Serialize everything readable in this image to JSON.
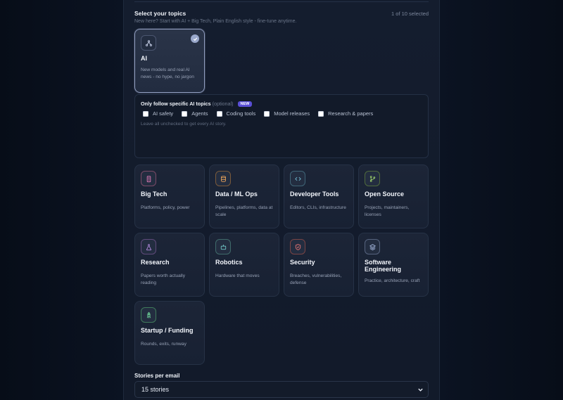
{
  "topics": {
    "title": "Select your topics",
    "count": "1 of 10 selected",
    "subtitle": "New here? Start with AI + Big Tech, Plain English style - fine-tune anytime."
  },
  "cards": [
    {
      "title": "AI",
      "desc": "New models and real AI news - no hype, no jargon",
      "icon": "network-icon",
      "color": "#aab4d4",
      "selected": true
    },
    {
      "title": "Big Tech",
      "desc": "Platforms, policy, power",
      "icon": "building-icon",
      "color": "#e07ab6"
    },
    {
      "title": "Data / ML Ops",
      "desc": "Pipelines, platforms, data at scale",
      "icon": "database-icon",
      "color": "#e8a25a"
    },
    {
      "title": "Developer Tools",
      "desc": "Editors, CLIs, infrastructure",
      "icon": "code-icon",
      "color": "#6fb6cf"
    },
    {
      "title": "Open Source",
      "desc": "Projects, maintainers, licenses",
      "icon": "git-branch-icon",
      "color": "#9bcf6a"
    },
    {
      "title": "Research",
      "desc": "Papers worth actually reading",
      "icon": "flask-icon",
      "color": "#b48be0"
    },
    {
      "title": "Robotics",
      "desc": "Hardware that moves",
      "icon": "robot-icon",
      "color": "#6fc4c4"
    },
    {
      "title": "Security",
      "desc": "Breaches, vulnerabilities, defense",
      "icon": "shield-icon",
      "color": "#e07272"
    },
    {
      "title": "Software Engineering",
      "desc": "Practice, architecture, craft",
      "icon": "layers-icon",
      "color": "#9fb2d8"
    },
    {
      "title": "Startup / Funding",
      "desc": "Rounds, exits, runway",
      "icon": "rocket-icon",
      "color": "#6fd49a"
    }
  ],
  "ai_filter": {
    "title": "Only follow specific AI topics",
    "optional": "(optional)",
    "badge": "NEW",
    "options": [
      "AI safety",
      "Agents",
      "Coding tools",
      "Model releases",
      "Research & papers"
    ],
    "hint": "Leave all unchecked to get every AI story."
  },
  "stories": {
    "label": "Stories per email",
    "value": "15 stories"
  }
}
